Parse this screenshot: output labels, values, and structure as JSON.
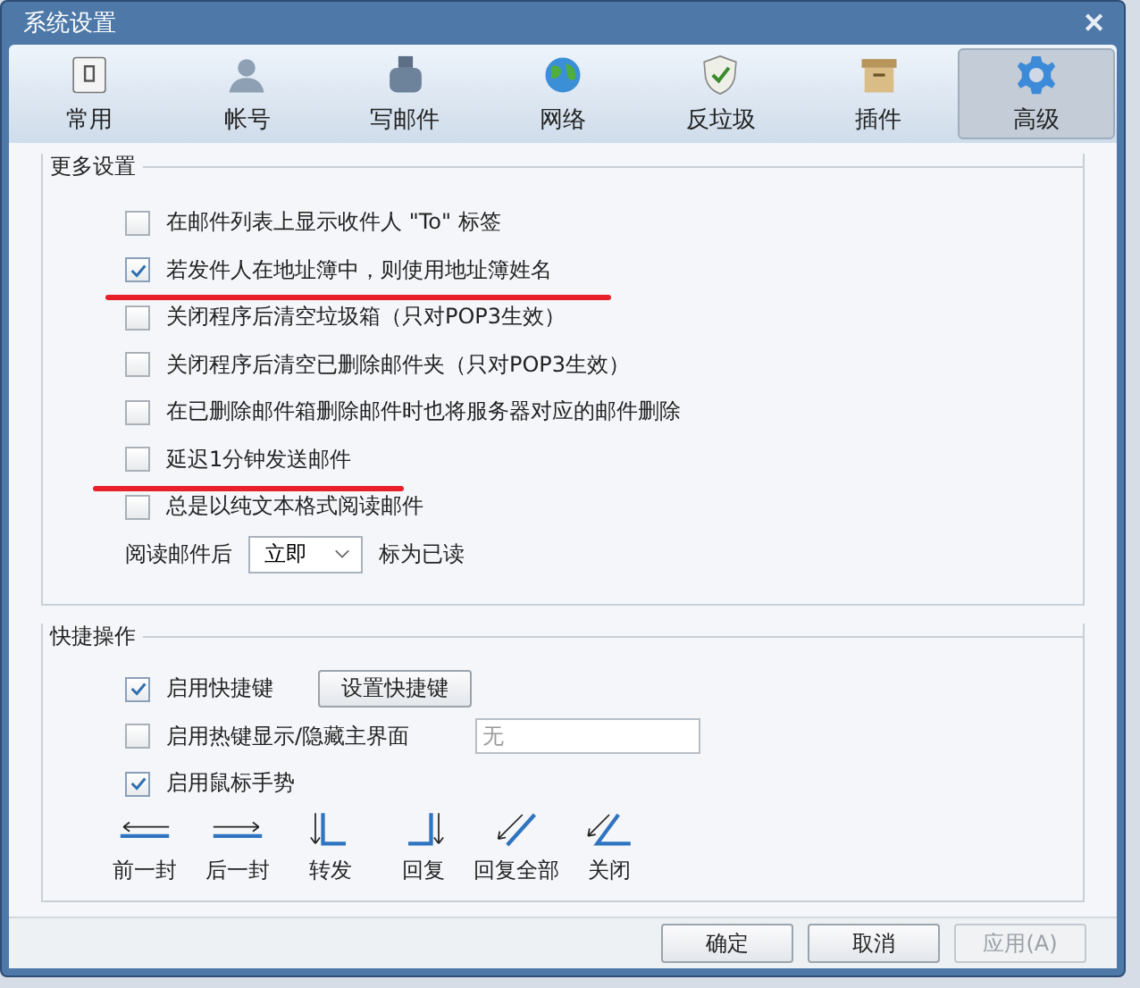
{
  "window": {
    "title": "系统设置",
    "close": "✕"
  },
  "tabs": [
    {
      "label": "常用",
      "selected": false
    },
    {
      "label": "帐号",
      "selected": false
    },
    {
      "label": "写邮件",
      "selected": false
    },
    {
      "label": "网络",
      "selected": false
    },
    {
      "label": "反垃圾",
      "selected": false
    },
    {
      "label": "插件",
      "selected": false
    },
    {
      "label": "高级",
      "selected": true
    }
  ],
  "more_settings": {
    "title": "更多设置",
    "options": [
      {
        "label": "在邮件列表上显示收件人 \"To\" 标签",
        "checked": false,
        "underlined": false
      },
      {
        "label": "若发件人在地址簿中，则使用地址簿姓名",
        "checked": true,
        "underlined": true
      },
      {
        "label": "关闭程序后清空垃圾箱（只对POP3生效）",
        "checked": false,
        "underlined": false
      },
      {
        "label": "关闭程序后清空已删除邮件夹（只对POP3生效）",
        "checked": false,
        "underlined": false
      },
      {
        "label": "在已删除邮件箱删除邮件时也将服务器对应的邮件删除",
        "checked": false,
        "underlined": false
      },
      {
        "label": "延迟1分钟发送邮件",
        "checked": false,
        "underlined": true
      },
      {
        "label": "总是以纯文本格式阅读邮件",
        "checked": false,
        "underlined": false
      }
    ],
    "read_mark": {
      "before": "阅读邮件后",
      "value": "立即",
      "after": "标为已读"
    }
  },
  "shortcuts": {
    "title": "快捷操作",
    "hotkeys": {
      "label": "启用快捷键",
      "checked": true,
      "button": "设置快捷键"
    },
    "show_hide": {
      "label": "启用热键显示/隐藏主界面",
      "checked": false,
      "placeholder": "无"
    },
    "gestures": {
      "label": "启用鼠标手势",
      "checked": true,
      "items": [
        {
          "kind": "left",
          "label": "前一封"
        },
        {
          "kind": "right",
          "label": "后一封"
        },
        {
          "kind": "forward",
          "label": "转发"
        },
        {
          "kind": "reply",
          "label": "回复"
        },
        {
          "kind": "reply_all",
          "label": "回复全部"
        },
        {
          "kind": "close",
          "label": "关闭"
        }
      ]
    }
  },
  "buttons": [
    {
      "label": "确定",
      "disabled": false
    },
    {
      "label": "取消",
      "disabled": false
    },
    {
      "label": "应用(A)",
      "disabled": true
    }
  ]
}
